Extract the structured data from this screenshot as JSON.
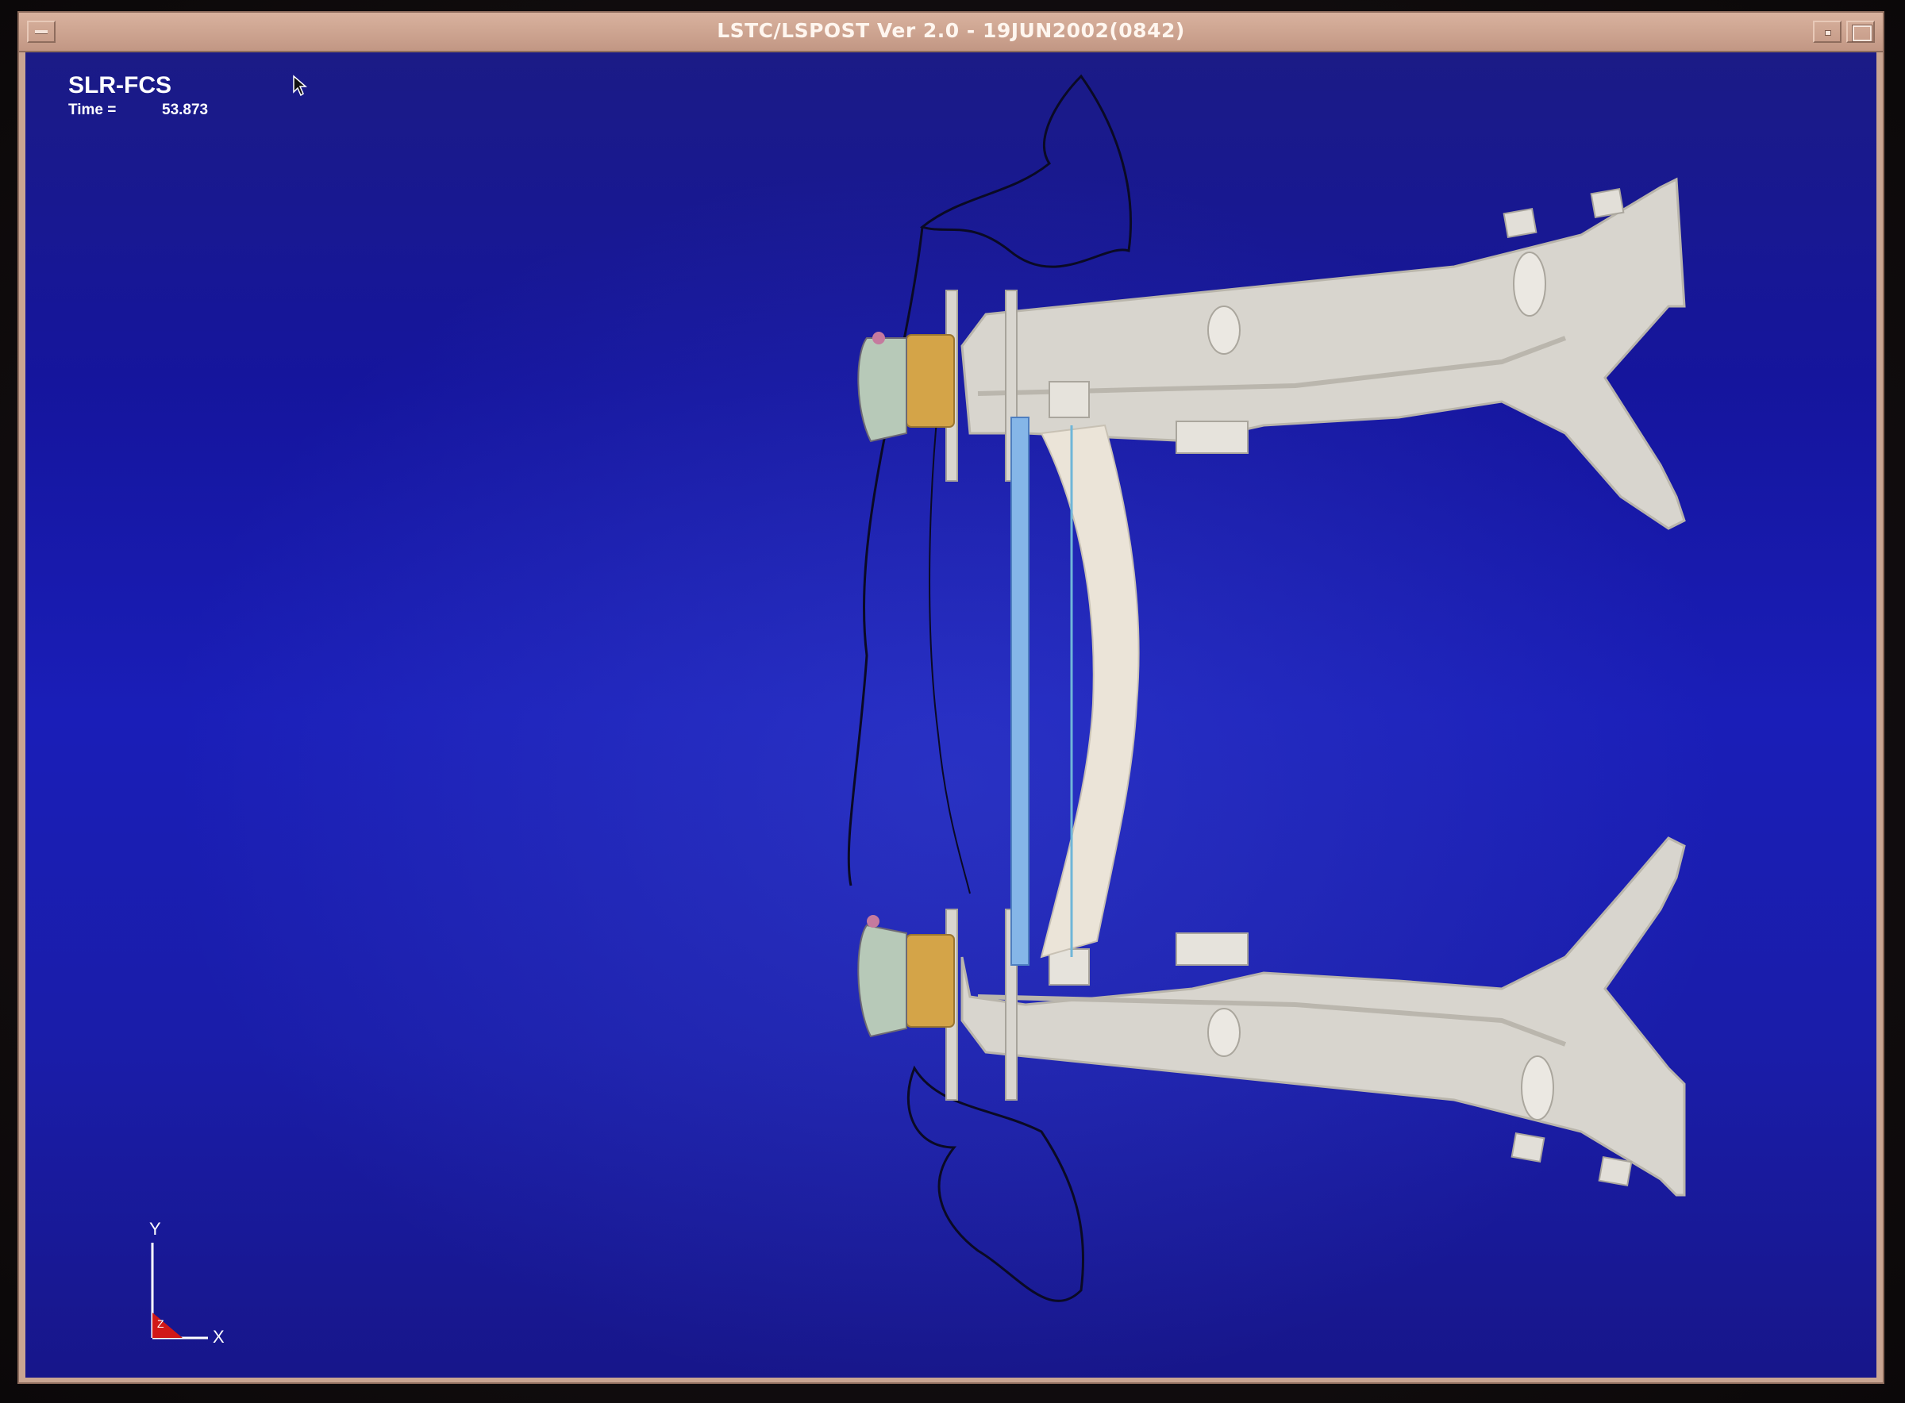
{
  "window": {
    "title": "LSTC/LSPOST Ver 2.0 - 19JUN2002(0842)"
  },
  "viewport": {
    "model_name": "SLR-FCS",
    "time_label": "Time =",
    "time_value": "53.873"
  },
  "triad": {
    "y_label": "Y",
    "x_label": "X",
    "z_label": "Z"
  },
  "icons": {
    "window_menu": "window-menu-icon",
    "minimize": "minimize-icon",
    "maximize": "maximize-icon",
    "pointer": "mouse-pointer-icon"
  },
  "colors": {
    "background": "#1a1eb8",
    "frame": "#c9a592",
    "structure": "#d9d6cf",
    "spool": "#d6a64a",
    "rod": "#7fb2e6",
    "outline": "#0b0b22"
  }
}
